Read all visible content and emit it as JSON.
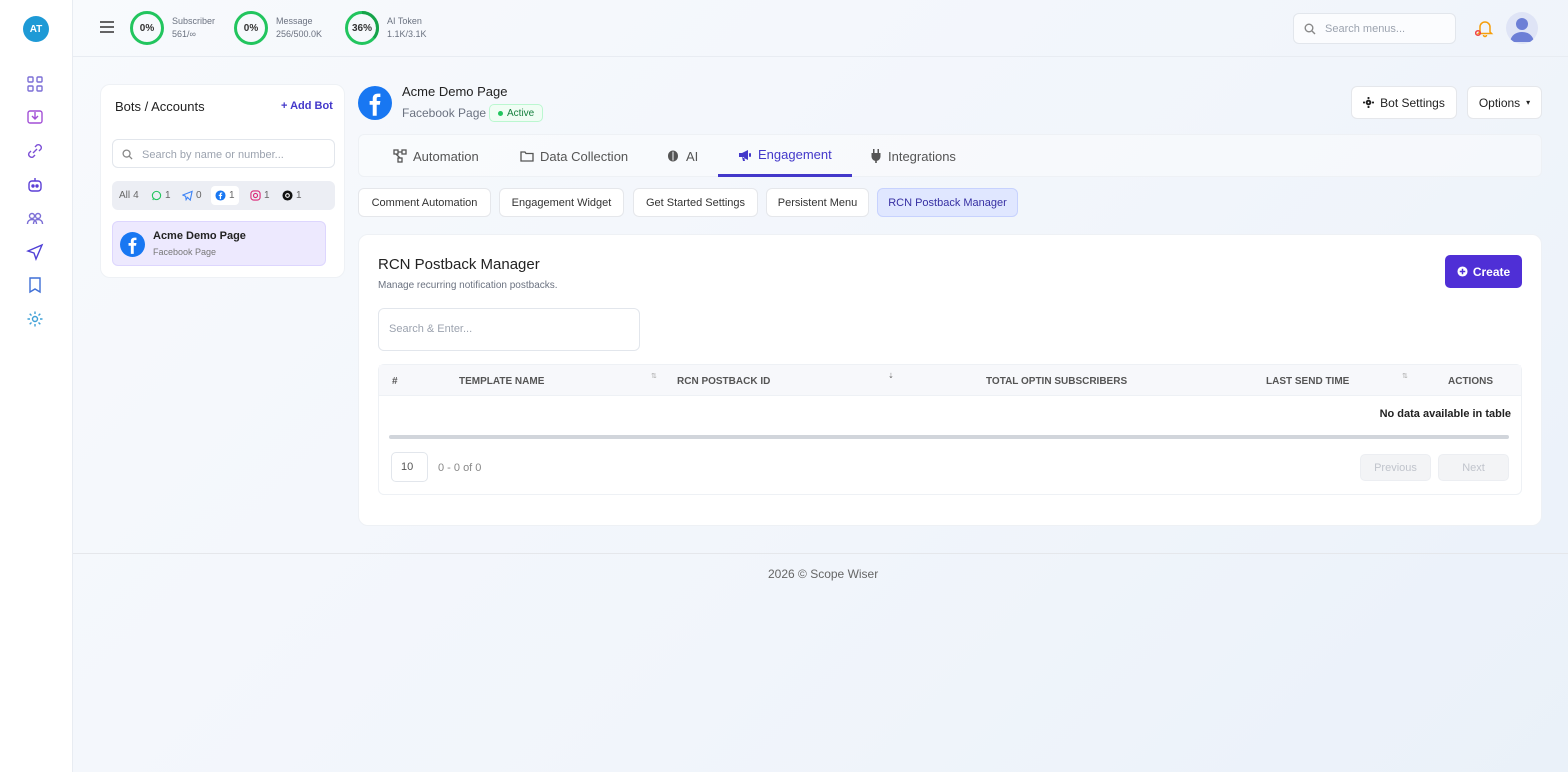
{
  "brand": {
    "avatar_initials": "AT"
  },
  "topbar": {
    "stats": [
      {
        "percent_label": "0%",
        "percent": 0,
        "label": "Subscriber",
        "value": "561/∞"
      },
      {
        "percent_label": "0%",
        "percent": 0,
        "label": "Message",
        "value": "256/500.0K"
      },
      {
        "percent_label": "36%",
        "percent": 36,
        "label": "AI Token",
        "value": "1.1K/3.1K"
      }
    ],
    "search_placeholder": "Search menus..."
  },
  "accounts": {
    "title": "Bots / Accounts",
    "add_label": "Add Bot",
    "search_placeholder": "Search by name or number...",
    "filters": [
      {
        "label": "All",
        "count": "4"
      },
      {
        "label": "whatsapp-icon",
        "count": "1"
      },
      {
        "label": "telegram-icon",
        "count": "0"
      },
      {
        "label": "facebook-icon",
        "count": "1"
      },
      {
        "label": "instagram-icon",
        "count": "1"
      },
      {
        "label": "threads-icon",
        "count": "1"
      }
    ],
    "items": [
      {
        "name": "Acme Demo Page",
        "type": "Facebook Page"
      }
    ]
  },
  "page": {
    "name": "Acme Demo Page",
    "type": "Facebook Page",
    "status": "Active",
    "bot_settings_label": "Bot Settings",
    "options_label": "Options"
  },
  "tabs": [
    {
      "label": "Automation",
      "icon": "flow-icon"
    },
    {
      "label": "Data Collection",
      "icon": "folder-icon"
    },
    {
      "label": "AI",
      "icon": "brain-icon"
    },
    {
      "label": "Engagement",
      "icon": "megaphone-icon",
      "active": true
    },
    {
      "label": "Integrations",
      "icon": "plug-icon"
    }
  ],
  "subtabs": [
    {
      "label": "Comment Automation"
    },
    {
      "label": "Engagement Widget"
    },
    {
      "label": "Get Started Settings"
    },
    {
      "label": "Persistent Menu"
    },
    {
      "label": "RCN Postback Manager",
      "active": true
    }
  ],
  "panel": {
    "title": "RCN Postback Manager",
    "subtitle": "Manage recurring notification postbacks.",
    "create_label": "Create",
    "search_placeholder": "Search & Enter...",
    "columns": [
      "#",
      "TEMPLATE NAME",
      "RCN POSTBACK ID",
      "TOTAL OPTIN SUBSCRIBERS",
      "LAST SEND TIME",
      "ACTIONS"
    ],
    "empty_message": "No data available in table",
    "page_size": "10",
    "page_info": "0 - 0 of 0",
    "prev_label": "Previous",
    "next_label": "Next"
  },
  "footer": {
    "text": "2026 © Scope Wiser"
  },
  "colors": {
    "accent": "#4f2fd6",
    "ring": "#22c55e",
    "active_green": "#15803d"
  }
}
